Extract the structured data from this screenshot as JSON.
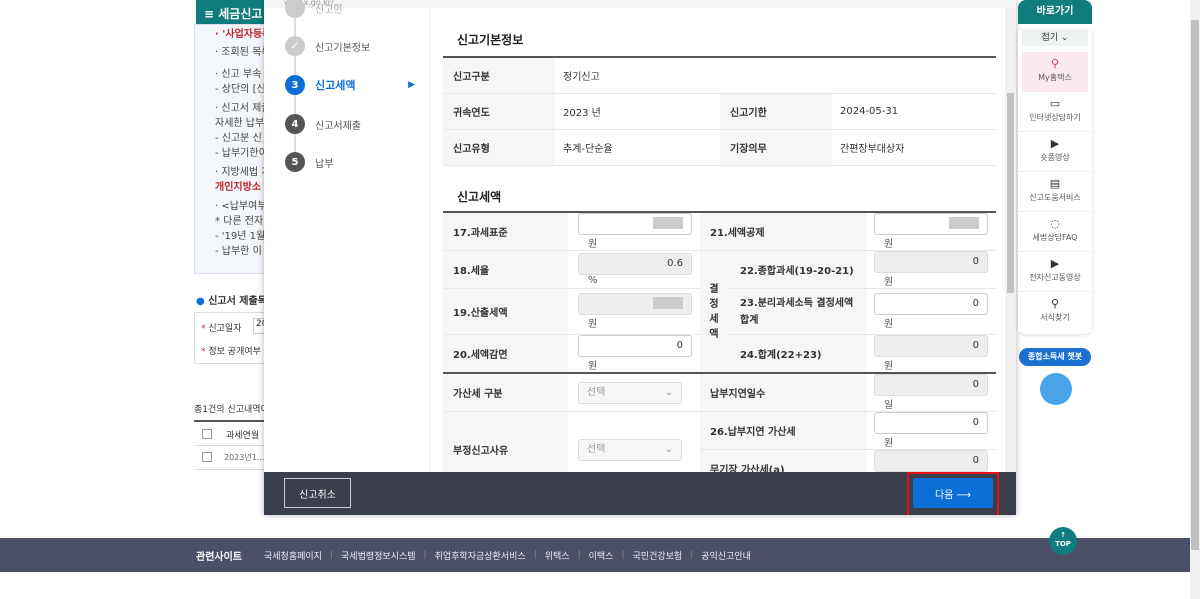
{
  "background": {
    "menu_title": "세금신고",
    "notice_lines": [
      "· '사업자등록",
      "· 조회된 목록",
      "· 신고 부속 ·",
      "- 상단의 [신",
      "· 신고서 제출",
      "자세한 납부",
      "- 신고분 신",
      "- 납부기한이",
      "· 지방세법 개",
      "개인지방소",
      "· <납부여부:",
      "* 다른 전자",
      "- '19년 1월",
      "- 납부한 이"
    ],
    "section_title": "신고서 제출목",
    "filter_labels": [
      "신고일자",
      "정보 공개여부"
    ],
    "filter_value": "20",
    "count_text": "총1건의 신고내역이",
    "table_header": "과세연월",
    "table_row": "2023년1..."
  },
  "modal": {
    "url": "wetax.go.kr/...",
    "steps": [
      {
        "num": "",
        "label": "신고인",
        "state": "done"
      },
      {
        "num": "✓",
        "label": "신고기본정보",
        "state": "done"
      },
      {
        "num": "3",
        "label": "신고세액",
        "state": "active"
      },
      {
        "num": "4",
        "label": "신고서제출",
        "state": "todo"
      },
      {
        "num": "5",
        "label": "납부",
        "state": "todo"
      }
    ],
    "basic": {
      "title": "신고기본정보",
      "rows": [
        {
          "label": "신고구분",
          "value": "정기신고"
        },
        {
          "label": "귀속연도",
          "value": "2023 년",
          "label2": "신고기한",
          "value2": "2024-05-31"
        },
        {
          "label": "신고유형",
          "value": "추계-단순율",
          "label2": "기장의무",
          "value2": "간편장부대상자"
        }
      ]
    },
    "tax": {
      "title": "신고세액",
      "group_label": "결정세액",
      "f17": {
        "label": "17.과세표준",
        "unit": "원"
      },
      "f18": {
        "label": "18.세율",
        "value": "0.6",
        "unit": "%"
      },
      "f19": {
        "label": "19.산출세액",
        "unit": "원"
      },
      "f20": {
        "label": "20.세액감면",
        "value": "0",
        "unit": "원"
      },
      "f21": {
        "label": "21.세액공제",
        "unit": "원"
      },
      "f22": {
        "label": "22.종합과세(19-20-21)",
        "value": "0",
        "unit": "원"
      },
      "f23": {
        "label": "23.분리과세소득 결정세액 합계",
        "value": "0",
        "unit": "원"
      },
      "f24": {
        "label": "24.합계(22+23)",
        "value": "0",
        "unit": "원"
      },
      "penalty_type": {
        "label": "가산세 구분",
        "value": "선택"
      },
      "delay_days": {
        "label": "납부지연일수",
        "value": "0",
        "unit": "일"
      },
      "f26": {
        "label": "26.납부지연 가산세",
        "value": "0",
        "unit": "원"
      },
      "fraud": {
        "label": "부정신고사유",
        "value": "선택"
      },
      "nobook": {
        "label": "무기장 가산세(a)",
        "value": "0",
        "unit": "원"
      }
    },
    "cancel_label": "신고취소",
    "next_label": "다음 ⟶"
  },
  "quick": {
    "title": "바로가기",
    "fold": "접기 ⌄",
    "items": [
      {
        "icon": "👤",
        "label": "My홈택스"
      },
      {
        "icon": "💻",
        "label": "인터넷상담하기"
      },
      {
        "icon": "▶",
        "label": "숏폼영상"
      },
      {
        "icon": "📖",
        "label": "신고도움서비스"
      },
      {
        "icon": "💬",
        "label": "세법상담FAQ"
      },
      {
        "icon": "▶",
        "label": "전자신고동영상"
      },
      {
        "icon": "🔍",
        "label": "서식찾기"
      }
    ],
    "chatbot": "종합소득세 챗봇"
  },
  "footer": {
    "title": "관련사이트",
    "links": [
      "국세청홈페이지",
      "국세법령정보시스템",
      "취업후학자금상환서비스",
      "위택스",
      "이택스",
      "국민건강보험",
      "공익신고안내"
    ]
  },
  "top_label": "TOP"
}
